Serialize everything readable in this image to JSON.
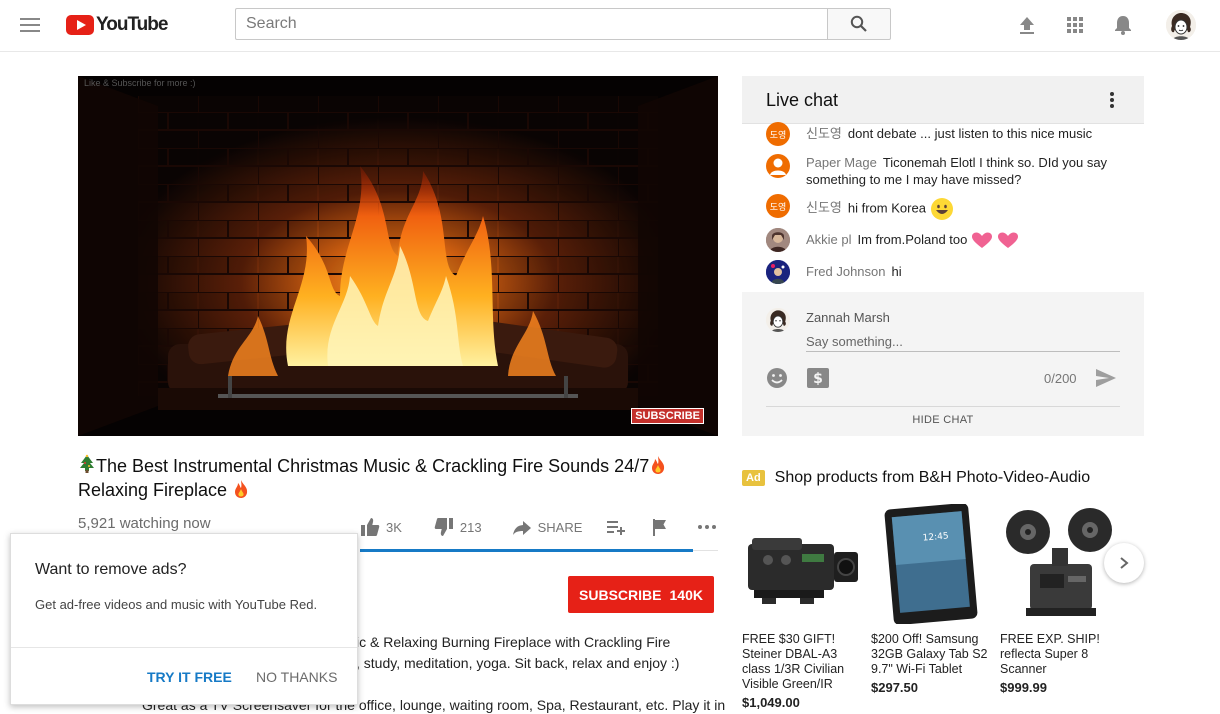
{
  "header": {
    "logo_text": "YouTube",
    "search_placeholder": "Search"
  },
  "player": {
    "overlay_text": "Like & Subscribe for more :)",
    "subscribe_watermark": "SUBSCRIBE"
  },
  "video": {
    "title_line1": "The Best Instrumental Christmas Music & Crackling Fire Sounds 24/7",
    "title_line2": "Relaxing Fireplace",
    "watching": "5,921 watching now",
    "like_count": "3K",
    "dislike_count": "213",
    "like_ratio": 0.93,
    "share_label": "SHARE",
    "subscribe_label": "SUBSCRIBE",
    "subscriber_count": "140K",
    "description": [
      "ic & Relaxing Burning Fireplace with Crackling Fire",
      ", study, meditation, yoga. Sit back, relax and enjoy :)",
      "Great as a TV Screensaver for the office,  lounge, waiting room, Spa, Restaurant, etc. Play it in"
    ]
  },
  "ad_popup": {
    "title": "Want to remove ads?",
    "text": "Get ad-free videos and music with YouTube Red.",
    "try_label": "TRY IT FREE",
    "no_label": "NO THANKS"
  },
  "chat": {
    "title": "Live chat",
    "messages": [
      {
        "author": "신도영",
        "text": "dont debate ... just listen to this nice music",
        "avatar": "도영"
      },
      {
        "author": "Paper Mage",
        "text": "Ticonemah Elotl I think so. DId you say something to me I may have missed?"
      },
      {
        "author": "신도영",
        "text": "hi from Korea",
        "avatar": "도영"
      },
      {
        "author": "Akkie pl",
        "text": "Im from.Poland too"
      },
      {
        "author": "Fred Johnson",
        "text": "hi"
      }
    ],
    "user_name": "Zannah Marsh",
    "input_placeholder": "Say something...",
    "char_count": "0/200",
    "hide_label": "HIDE CHAT"
  },
  "shop": {
    "ad_label": "Ad",
    "title": "Shop products from B&H Photo-Video-Audio",
    "products": [
      {
        "name": "FREE $30 GIFT! Steiner DBAL-A3 class 1/3R Civilian Visible Green/IR",
        "price": "$1,049.00"
      },
      {
        "name": "$200 Off! Samsung 32GB Galaxy Tab S2 9.7\" Wi-Fi Tablet",
        "price": "$297.50"
      },
      {
        "name": "FREE EXP. SHIP! reflecta Super 8 Scanner",
        "price": "$999.99"
      }
    ]
  },
  "colors": {
    "brand_red": "#e62117",
    "link_blue": "#167ac6",
    "ad_yellow": "#e8c23e"
  }
}
